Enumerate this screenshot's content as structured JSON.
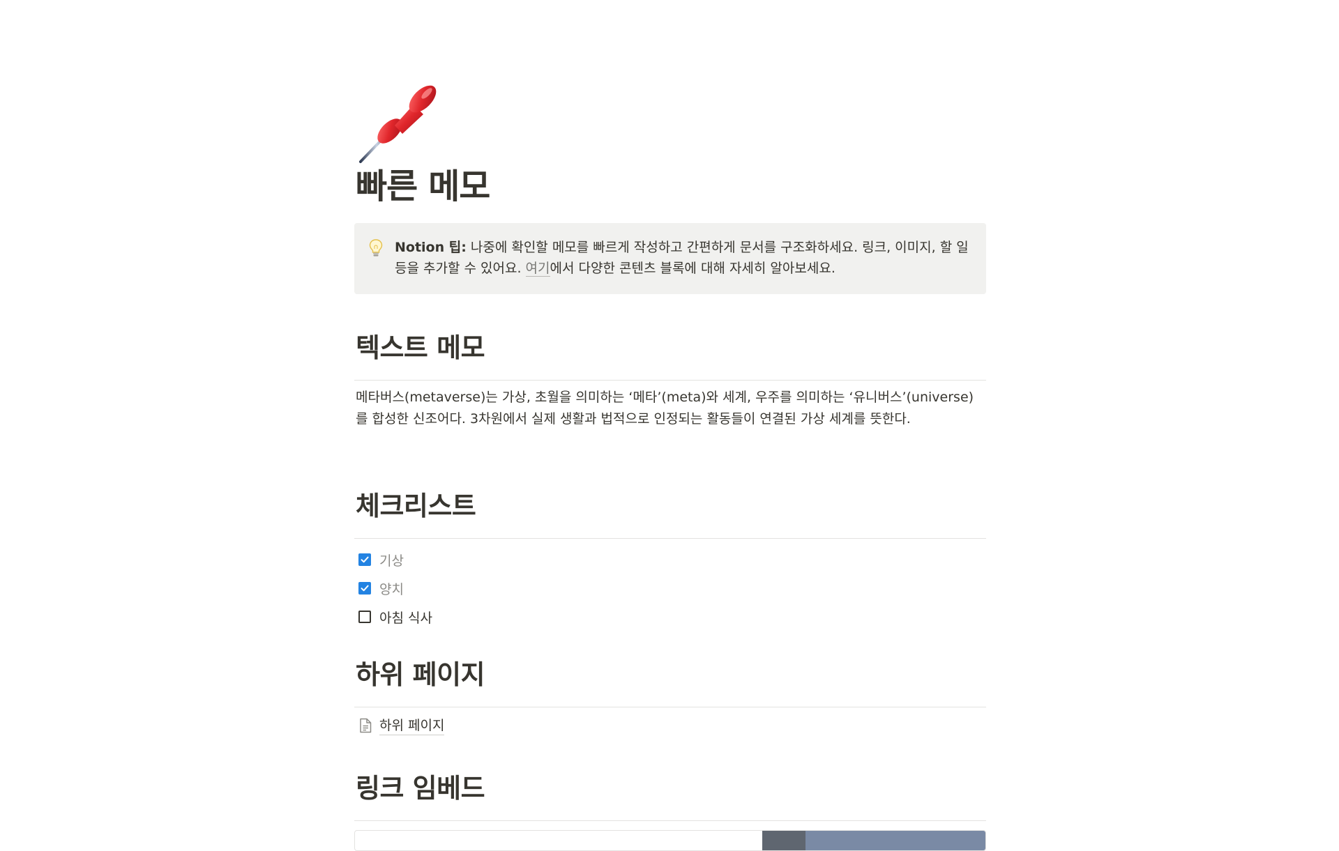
{
  "page": {
    "icon": "pushpin-icon",
    "title": "빠른 메모"
  },
  "callout": {
    "icon": "lightbulb-icon",
    "label": "Notion 팁:",
    "text_before_link": " 나중에 확인할 메모를 빠르게 작성하고 간편하게 문서를 구조화하세요. 링크, 이미지, 할 일 등을 추가할 수 있어요. ",
    "link_text": "여기",
    "text_after_link": "에서 다양한 콘텐츠 블록에 대해 자세히 알아보세요."
  },
  "sections": {
    "text_memo": {
      "heading": "텍스트 메모",
      "body": "메타버스(metaverse)는 가상, 초월을 의미하는 ‘메타’(meta)와 세계, 우주를 의미하는 ‘유니버스’(universe)를 합성한 신조어다. 3차원에서 실제 생활과 법적으로 인정되는 활동들이 연결된 가상 세계를 뜻한다."
    },
    "checklist": {
      "heading": "체크리스트",
      "items": [
        {
          "label": "기상",
          "checked": true
        },
        {
          "label": "양치",
          "checked": true
        },
        {
          "label": "아침 식사",
          "checked": false
        }
      ]
    },
    "subpages": {
      "heading": "하위 페이지",
      "page_icon": "document-icon",
      "page_label": "하위 페이지"
    },
    "link_embed": {
      "heading": "링크 임베드"
    }
  },
  "colors": {
    "text": "#37352f",
    "callout_bg": "#f1f1ef",
    "checkbox_checked": "#2383e2",
    "divider": "#e3e2e0",
    "done_text": "#8b8a86"
  }
}
